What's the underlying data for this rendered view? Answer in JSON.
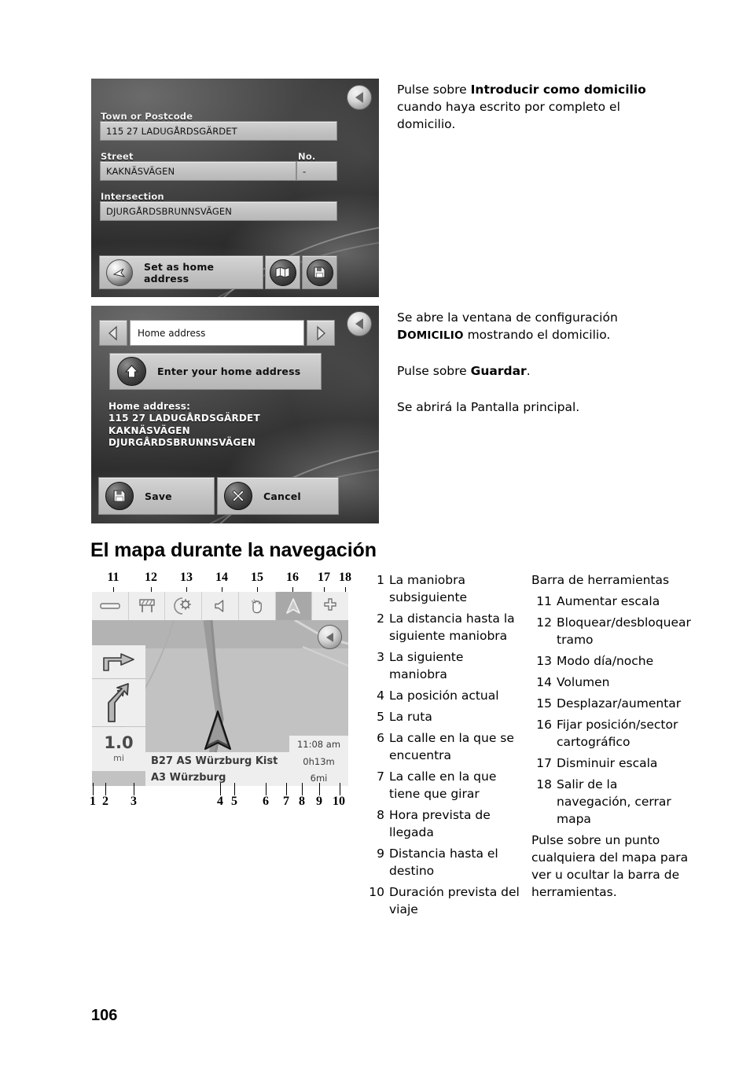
{
  "page": {
    "number": "106"
  },
  "screenshot_address": {
    "name": "address-entry-screen",
    "back_icon": "back-arrow-icon",
    "fields": [
      {
        "label": "Town or Postcode",
        "value": "115 27 LADUGÅRDSGÄRDET"
      },
      {
        "label": "Street",
        "value": "KAKNÄSVÄGEN"
      },
      {
        "label": "No.",
        "value": "-"
      },
      {
        "label": "Intersection",
        "value": "DJURGÅRDSBRUNNSVÄGEN"
      }
    ],
    "buttons": {
      "set_home": "Set as home address",
      "show_on_map_icon": "map-icon",
      "save_icon": "save-disk-icon"
    }
  },
  "screenshot_home": {
    "name": "home-address-settings-screen",
    "prev_icon": "chevron-left-icon",
    "next_icon": "chevron-right-icon",
    "back_icon": "back-arrow-icon",
    "title_value": "Home address",
    "enter_button": "Enter your home address",
    "enter_button_icon": "house-icon",
    "home_address_label": "Home address:",
    "home_address_lines": [
      "115 27 LADUGÅRDSGÄRDET",
      "KAKNÄSVÄGEN",
      "DJURGÅRDSBRUNNSVÄGEN"
    ],
    "save_button": "Save",
    "save_icon": "save-disk-icon",
    "cancel_button": "Cancel",
    "cancel_icon": "cross-tool-icon"
  },
  "instructions": {
    "p1_pre": "Pulse sobre ",
    "p1_bold": "Introducir como domicilio",
    "p1_post": " cuando haya escrito por completo el domicilio.",
    "p2_pre": "Se abre la ventana de configuración ",
    "p2_sc_first": "D",
    "p2_sc_rest": "OMICILIO",
    "p2_post": " mostrando el domicilio.",
    "p3_pre": "Pulse sobre ",
    "p3_bold": "Guardar",
    "p3_post": ".",
    "p4": "Se abrirá la Pantalla principal."
  },
  "heading": "El mapa durante la navegación",
  "map_screenshot": {
    "name": "navigation-map-screen",
    "toolbar_icons": [
      "minus-zoom-out-icon",
      "road-block-icon",
      "day-night-sun-moon-icon",
      "volume-speaker-icon",
      "pan-hand-icon",
      "fix-position-arrow-icon",
      "plus-zoom-in-icon"
    ],
    "back_icon": "back-arrow-icon",
    "next_maneuver_icon": "turn-right-ahead-icon",
    "following_maneuver_icon": "fork-right-icon",
    "distance_value": "1.0",
    "distance_unit": "mi",
    "turn_street": "B27 AS Würzburg Kist",
    "current_street": "A3 Würzburg",
    "arrival_time": "11:08 am",
    "trip_duration": "0h13m",
    "remaining_distance": "6mi",
    "callouts_bottom": [
      "1",
      "2",
      "3",
      "4",
      "5",
      "6",
      "7",
      "8",
      "9",
      "10"
    ],
    "callouts_top": [
      "11",
      "12",
      "13",
      "14",
      "15",
      "16",
      "17",
      "18"
    ]
  },
  "legend_left": [
    {
      "num": "1",
      "text": "La maniobra subsiguiente"
    },
    {
      "num": "2",
      "text": "La distancia hasta la siguiente maniobra"
    },
    {
      "num": "3",
      "text": "La siguiente maniobra"
    },
    {
      "num": "4",
      "text": "La posición actual"
    },
    {
      "num": "5",
      "text": "La ruta"
    },
    {
      "num": "6",
      "text": "La calle en la que se encuentra"
    },
    {
      "num": "7",
      "text": "La calle en la que tiene que girar"
    },
    {
      "num": "8",
      "text": "Hora prevista de llegada"
    },
    {
      "num": "9",
      "text": "Distancia hasta el destino"
    },
    {
      "num": "10",
      "text": "Duración prevista del viaje"
    }
  ],
  "legend_right_header": "Barra de herramientas",
  "legend_right": [
    {
      "num": "11",
      "text": "Aumentar escala"
    },
    {
      "num": "12",
      "text": "Bloquear/desbloquear tramo"
    },
    {
      "num": "13",
      "text": "Modo día/noche"
    },
    {
      "num": "14",
      "text": "Volumen"
    },
    {
      "num": "15",
      "text": "Desplazar/aumentar"
    },
    {
      "num": "16",
      "text": "Fijar posición/sector cartográfico"
    },
    {
      "num": "17",
      "text": "Disminuir escala"
    },
    {
      "num": "18",
      "text": "Salir de la navegación, cerrar mapa"
    }
  ],
  "legend_right_footer": "Pulse sobre un punto cualquiera del mapa para ver u ocultar la barra de herramientas."
}
